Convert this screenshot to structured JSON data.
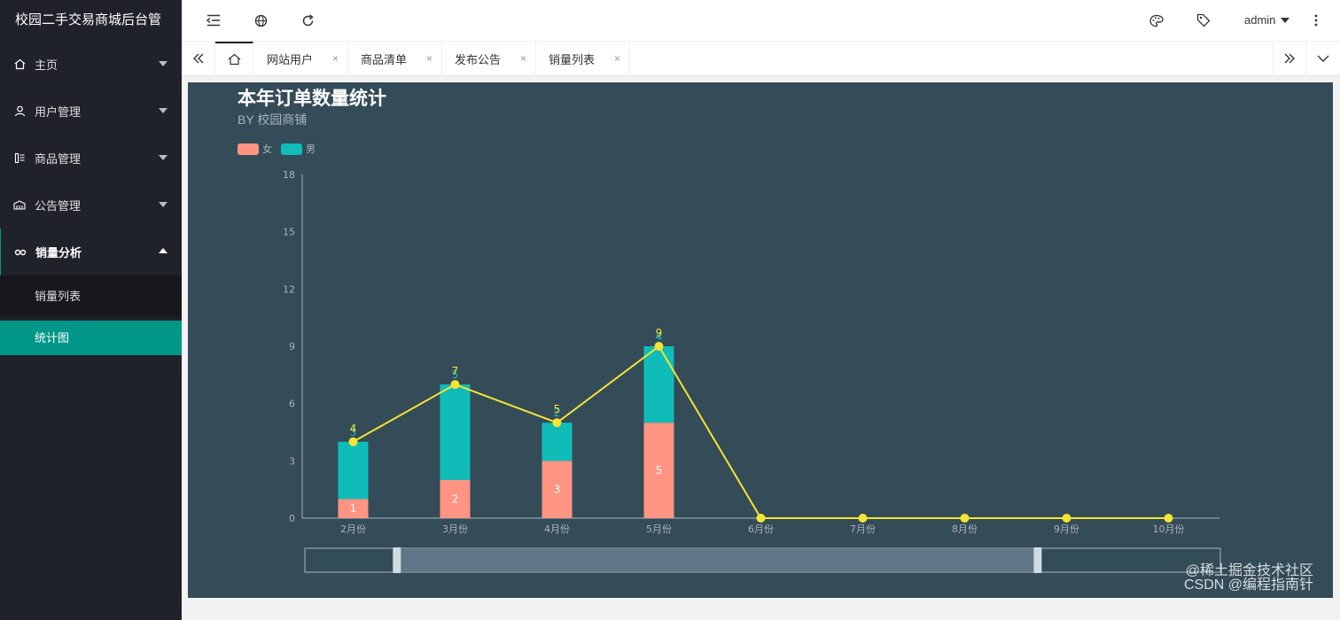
{
  "app": {
    "title": "校园二手交易商城后台管"
  },
  "sidebar": {
    "items": [
      {
        "label": "主页",
        "icon": "home-icon"
      },
      {
        "label": "用户管理",
        "icon": "user-icon"
      },
      {
        "label": "商品管理",
        "icon": "goods-icon"
      },
      {
        "label": "公告管理",
        "icon": "announce-icon"
      },
      {
        "label": "销量分析",
        "icon": "analysis-icon"
      }
    ],
    "subitems": [
      {
        "label": "销量列表",
        "active": false
      },
      {
        "label": "统计图",
        "active": true
      }
    ]
  },
  "header": {
    "icons": [
      "menu-fold-icon",
      "globe-icon",
      "refresh-icon",
      "theme-icon",
      "tag-icon",
      "more-icon"
    ],
    "user": "admin"
  },
  "tabs": [
    {
      "label": "网站用户"
    },
    {
      "label": "商品清单"
    },
    {
      "label": "发布公告"
    },
    {
      "label": "销量列表"
    }
  ],
  "chart": {
    "title": "本年订单数量统计",
    "subtitle": "BY 校园商铺"
  },
  "chart_data": {
    "type": "bar",
    "categories": [
      "2月份",
      "3月份",
      "4月份",
      "5月份",
      "6月份",
      "7月份",
      "8月份",
      "9月份",
      "10月份"
    ],
    "series": [
      {
        "name": "女",
        "type": "bar",
        "stack": "total",
        "color": "#ff9482",
        "values": [
          1,
          2,
          3,
          5,
          0,
          0,
          0,
          0,
          0
        ]
      },
      {
        "name": "男",
        "type": "bar",
        "stack": "total",
        "color": "#0fbcb8",
        "values": [
          3,
          5,
          2,
          4,
          0,
          0,
          0,
          0,
          0
        ]
      },
      {
        "type": "line",
        "color": "#f5e431",
        "values": [
          4,
          7,
          5,
          9,
          0,
          0,
          0,
          0,
          0
        ]
      }
    ],
    "ylim": [
      0,
      18
    ],
    "yticks": [
      0,
      3,
      6,
      9,
      12,
      15,
      18
    ],
    "datazoom_range": [
      0.1,
      0.8
    ]
  },
  "watermark": [
    "@稀土掘金技术社区",
    "CSDN @编程指南针"
  ]
}
